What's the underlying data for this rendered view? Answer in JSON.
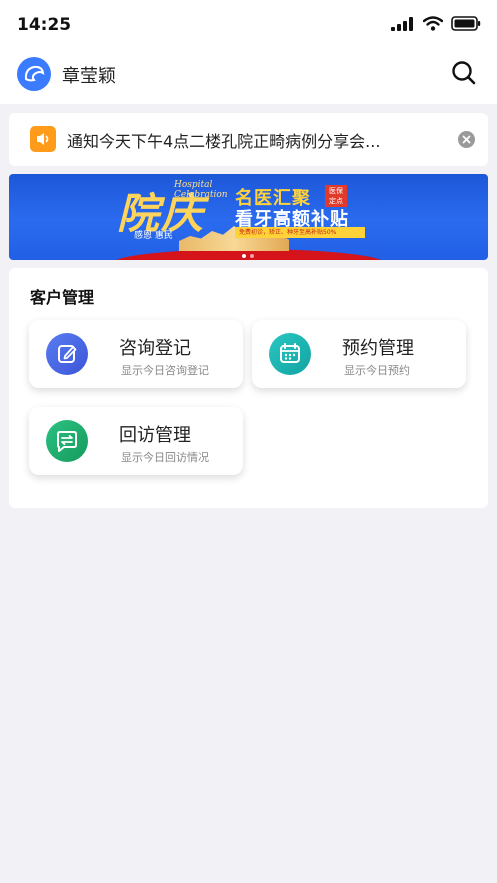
{
  "status_bar": {
    "time": "14:25"
  },
  "header": {
    "user_name": "章莹颖"
  },
  "notice": {
    "text": "通知今天下午4点二楼孔院正畸病例分享会..."
  },
  "banner": {
    "script_title": "院庆",
    "english": [
      "Hospital",
      "Celebration"
    ],
    "subtitle": "感恩 惠民",
    "headline1": "名医汇聚",
    "tag": [
      "医保",
      "定点"
    ],
    "headline2": "看牙高额补贴",
    "strip": "免费初诊，矫正、种牙至高补贴50%",
    "dot_count": 2,
    "active_dot": 0
  },
  "section": {
    "title": "客户管理",
    "cards": [
      {
        "title": "咨询登记",
        "subtitle": "显示今日咨询登记"
      },
      {
        "title": "预约管理",
        "subtitle": "显示今日预约"
      },
      {
        "title": "回访管理",
        "subtitle": "显示今日回访情况"
      }
    ]
  },
  "colors": {
    "logo": "#3a7bff",
    "notice_icon": "#ff9b1a",
    "consult_icon": "#4a67e6",
    "appointment_icon": "#17b3b0",
    "followup_icon": "#1fae6e"
  },
  "icons": {
    "notice": "speaker-icon",
    "consult": "edit-icon",
    "appointment": "calendar-icon",
    "followup": "chat-swap-icon"
  }
}
